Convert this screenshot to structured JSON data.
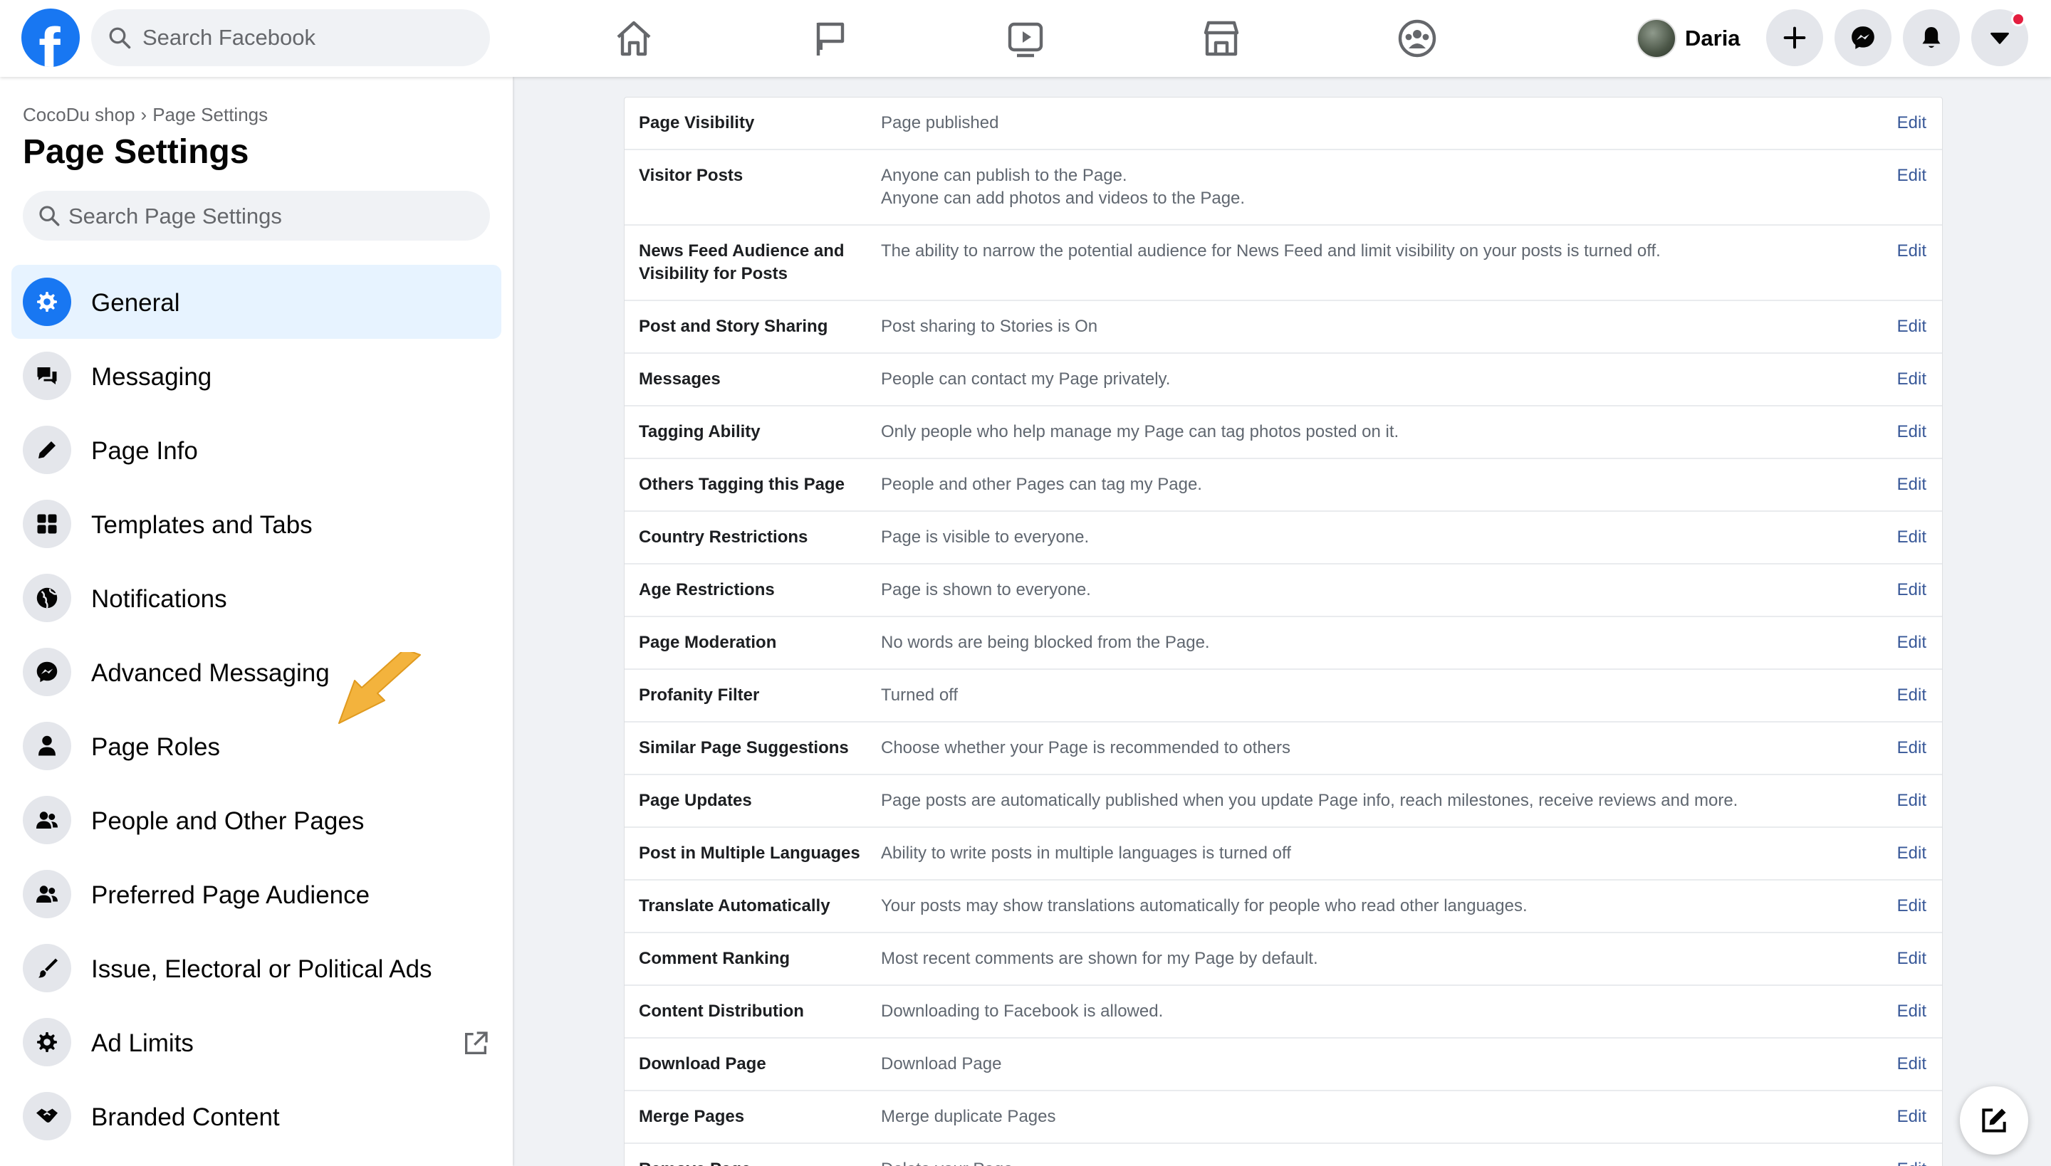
{
  "topbar": {
    "search_placeholder": "Search Facebook",
    "nav_icons": [
      "home-icon",
      "flag-icon",
      "watch-icon",
      "marketplace-icon",
      "groups-icon"
    ],
    "user_name": "Daria",
    "actions": [
      "create-icon",
      "messenger-icon",
      "notifications-icon",
      "account-menu-icon"
    ]
  },
  "sidebar": {
    "breadcrumb": [
      "CocoDu shop",
      "Page Settings"
    ],
    "title": "Page Settings",
    "search_placeholder": "Search Page Settings",
    "items": [
      {
        "label": "General",
        "icon": "gear-icon",
        "active": true
      },
      {
        "label": "Messaging",
        "icon": "chat-bubbles-icon"
      },
      {
        "label": "Page Info",
        "icon": "pencil-icon"
      },
      {
        "label": "Templates and Tabs",
        "icon": "grid-icon"
      },
      {
        "label": "Notifications",
        "icon": "globe-icon"
      },
      {
        "label": "Advanced Messaging",
        "icon": "messenger-icon"
      },
      {
        "label": "Page Roles",
        "icon": "person-icon"
      },
      {
        "label": "People and Other Pages",
        "icon": "people-icon"
      },
      {
        "label": "Preferred Page Audience",
        "icon": "people-icon"
      },
      {
        "label": "Issue, Electoral or Political Ads",
        "icon": "brush-icon"
      },
      {
        "label": "Ad Limits",
        "icon": "gear-icon",
        "external": true
      },
      {
        "label": "Branded Content",
        "icon": "handshake-icon"
      }
    ]
  },
  "settings": {
    "edit_label": "Edit",
    "rows": [
      {
        "name": "Page Visibility",
        "value": "Page published"
      },
      {
        "name": "Visitor Posts",
        "value": "Anyone can publish to the Page.\nAnyone can add photos and videos to the Page."
      },
      {
        "name": "News Feed Audience and Visibility for Posts",
        "value": "The ability to narrow the potential audience for News Feed and limit visibility on your posts is turned off."
      },
      {
        "name": "Post and Story Sharing",
        "value": "Post sharing to Stories is On"
      },
      {
        "name": "Messages",
        "value": "People can contact my Page privately."
      },
      {
        "name": "Tagging Ability",
        "value": "Only people who help manage my Page can tag photos posted on it."
      },
      {
        "name": "Others Tagging this Page",
        "value": "People and other Pages can tag my Page."
      },
      {
        "name": "Country Restrictions",
        "value": "Page is visible to everyone."
      },
      {
        "name": "Age Restrictions",
        "value": "Page is shown to everyone."
      },
      {
        "name": "Page Moderation",
        "value": "No words are being blocked from the Page."
      },
      {
        "name": "Profanity Filter",
        "value": "Turned off"
      },
      {
        "name": "Similar Page Suggestions",
        "value": "Choose whether your Page is recommended to others"
      },
      {
        "name": "Page Updates",
        "value": "Page posts are automatically published when you update Page info, reach milestones, receive reviews and more."
      },
      {
        "name": "Post in Multiple Languages",
        "value": "Ability to write posts in multiple languages is turned off"
      },
      {
        "name": "Translate Automatically",
        "value": "Your posts may show translations automatically for people who read other languages."
      },
      {
        "name": "Comment Ranking",
        "value": "Most recent comments are shown for my Page by default."
      },
      {
        "name": "Content Distribution",
        "value": "Downloading to Facebook is allowed."
      },
      {
        "name": "Download Page",
        "value": "Download Page"
      },
      {
        "name": "Merge Pages",
        "value": "Merge duplicate Pages"
      },
      {
        "name": "Remove Page",
        "value": "Delete your Page"
      }
    ]
  },
  "colors": {
    "brand": "#1877f2",
    "link": "#385898",
    "active_bg": "#e7f3ff",
    "notification_dot": "#e41e3f",
    "annotation_arrow": "#f3b33d"
  }
}
